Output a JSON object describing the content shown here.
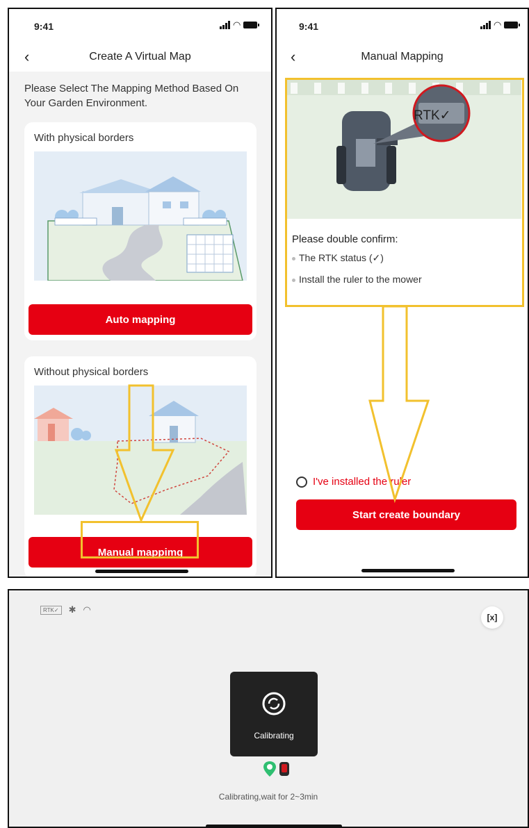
{
  "panel_auto": {
    "time": "9:41",
    "title": "Create A Virtual Map",
    "intro": "Please Select The Mapping Method Based On Your Garden Environment.",
    "auto_card": {
      "title": "With physical borders",
      "button": "Auto mapping"
    },
    "manual_card": {
      "title": "Without physical borders",
      "button": "Manual mappimg"
    }
  },
  "panel_manual": {
    "time": "9:41",
    "title": "Manual Mapping",
    "rtk_badge": "RTK✓",
    "confirm_title": "Please double confirm:",
    "bullets": [
      "The RTK status (✓)",
      "Install the ruler to the mower"
    ],
    "checkbox_label": "I've installed the ruler",
    "start_button": "Start create boundary"
  },
  "panel_calibrating": {
    "rtk_chip": "RTK✓",
    "close_icon": "[x]",
    "status": "Calibrating",
    "message": "Calibrating,wait for 2~3min"
  },
  "colors": {
    "accent_red": "#e60012",
    "highlight_yellow": "#f2c12e"
  },
  "icons": [
    "signal-icon",
    "wifi-icon",
    "battery-icon",
    "back-chevron-icon",
    "bluetooth-icon",
    "close-icon",
    "calibrating-icon",
    "location-pin-icon",
    "mower-icon"
  ]
}
